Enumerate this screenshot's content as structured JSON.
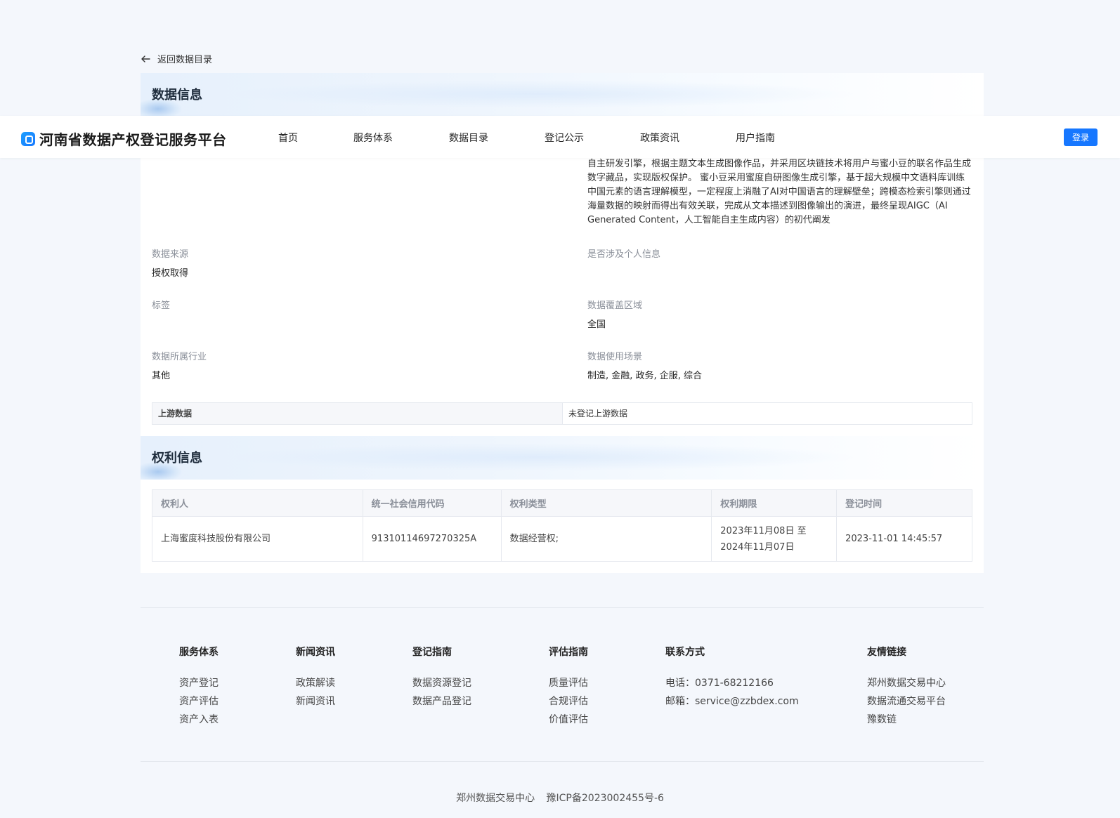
{
  "back": {
    "label": "返回数据目录"
  },
  "data_section": {
    "title": "数据信息",
    "description": "自主研发引擎，根据主题文本生成图像作品，并采用区块链技术将用户与蜜小豆的联名作品生成数字藏品，实现版权保护。 蜜小豆采用蜜度自研图像生成引擎，基于超大规模中文语料库训练中国元素的语言理解模型，一定程度上消融了AI对中国语言的理解壁垒；跨模态检索引擎则通过海量数据的映射而得出有效关联，完成从文本描述到图像输出的演进，最终呈现AIGC（AI Generated Content，人工智能自主生成内容）的初代阐发",
    "fields": [
      {
        "label": "数据来源",
        "value": "授权取得"
      },
      {
        "label": "是否涉及个人信息",
        "value": ""
      },
      {
        "label": "标签",
        "value": ""
      },
      {
        "label": "数据覆盖区域",
        "value": "全国"
      },
      {
        "label": "数据所属行业",
        "value": "其他"
      },
      {
        "label": "数据使用场景",
        "value": "制造, 金融, 政务, 企服, 综合"
      }
    ],
    "upstream": {
      "label": "上游数据",
      "value": "未登记上游数据"
    }
  },
  "rights_section": {
    "title": "权利信息",
    "headers": [
      "权利人",
      "统一社会信用代码",
      "权利类型",
      "权利期限",
      "登记时间"
    ],
    "rows": [
      {
        "holder": "上海蜜度科技股份有限公司",
        "code": "91310114697270325A",
        "type": "数据经营权;",
        "period_start": "2023年11月08日 至",
        "period_end": "2024年11月07日",
        "time": "2023-11-01 14:45:57"
      }
    ]
  },
  "nav": {
    "brand": "河南省数据产权登记服务平台",
    "items": [
      "首页",
      "服务体系",
      "数据目录",
      "登记公示",
      "政策资讯",
      "用户指南"
    ],
    "login": "登录"
  },
  "footer": {
    "columns": [
      {
        "title": "服务体系",
        "items": [
          "资产登记",
          "资产评估",
          "资产入表"
        ]
      },
      {
        "title": "新闻资讯",
        "items": [
          "政策解读",
          "新闻资讯"
        ]
      },
      {
        "title": "登记指南",
        "items": [
          "数据资源登记",
          "数据产品登记"
        ]
      },
      {
        "title": "评估指南",
        "items": [
          "质量评估",
          "合规评估",
          "价值评估"
        ]
      },
      {
        "title": "联系方式",
        "items": [
          "电话：0371-68212166",
          "邮箱：service@zzbdex.com"
        ]
      },
      {
        "title": "友情链接",
        "items": [
          "郑州数据交易中心",
          "数据流通交易平台",
          "豫数链"
        ]
      }
    ],
    "org": "郑州数据交易中心",
    "icp": "豫ICP备2023002455号-6"
  },
  "colors": {
    "primary": "#1677ff",
    "page_bg": "#f4f7fc"
  }
}
